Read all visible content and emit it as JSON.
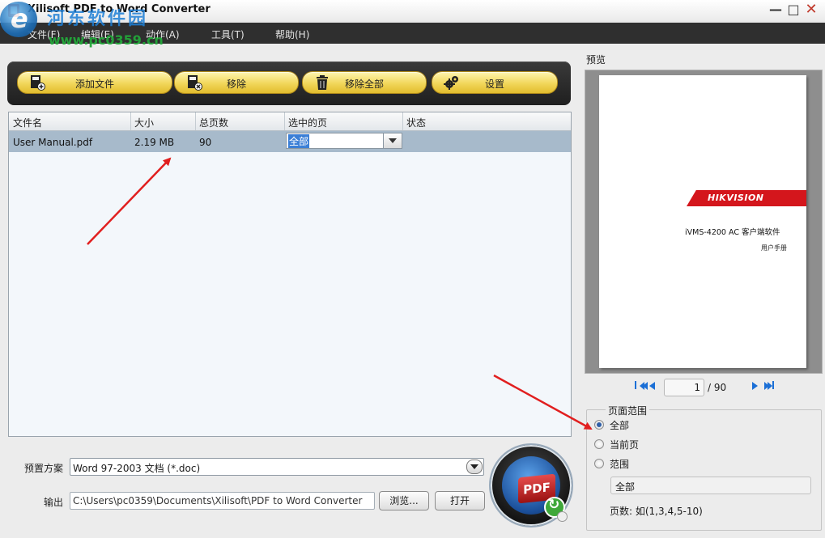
{
  "window": {
    "title": "Xilisoft PDF to Word Converter",
    "controls": {
      "minimize": "—",
      "maximize": "□",
      "close": "✕"
    }
  },
  "watermark": {
    "text": "河东软件园",
    "url": "www.pc0359.cn"
  },
  "menu": [
    {
      "label": "文件(F)"
    },
    {
      "label": "编辑(E)"
    },
    {
      "label": "动作(A)"
    },
    {
      "label": "工具(T)"
    },
    {
      "label": "帮助(H)"
    }
  ],
  "toolbar": {
    "add_file": "添加文件",
    "remove": "移除",
    "remove_all": "移除全部",
    "settings": "设置"
  },
  "table": {
    "columns": [
      "文件名",
      "大小",
      "总页数",
      "选中的页",
      "状态"
    ],
    "rows": [
      {
        "name": "User Manual.pdf",
        "size": "2.19 MB",
        "pages": "90",
        "selected": "全部",
        "status": ""
      }
    ]
  },
  "bottom": {
    "preset_label": "预置方案",
    "preset_value": "Word 97-2003 文档 (*.doc)",
    "output_label": "输出",
    "output_value": "C:\\Users\\pc0359\\Documents\\Xilisoft\\PDF to Word Converter",
    "browse": "浏览...",
    "open": "打开",
    "convert_badge": "PDF"
  },
  "preview": {
    "label": "预览",
    "page_brand": "HIKVISION",
    "page_title": "iVMS-4200 AC 客户端软件",
    "page_subtitle": "用户手册",
    "current_page": "1",
    "total_pages": "/ 90"
  },
  "page_range": {
    "title": "页面范围",
    "options": [
      "全部",
      "当前页",
      "范围"
    ],
    "selected": "全部",
    "range_value": "全部",
    "hint": "页数: 如(1,3,4,5-10)"
  },
  "colors": {
    "accent_yellow": "#f1d65a",
    "selection_row": "#a7bacb",
    "menubar": "#2f2f2f",
    "annotation_red": "#e11f1f"
  }
}
